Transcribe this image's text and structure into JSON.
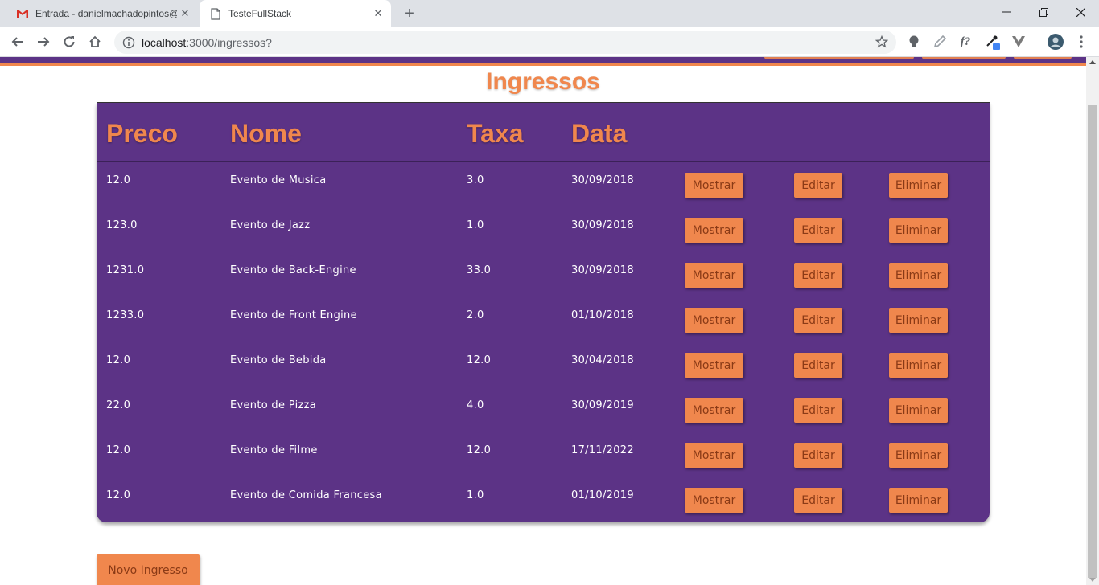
{
  "browser": {
    "tabs": [
      {
        "title": "Entrada - danielmachadopintos@",
        "icon": "gmail-icon",
        "active": false
      },
      {
        "title": "TesteFullStack",
        "icon": "page-icon",
        "active": true
      }
    ],
    "close_glyph": "✕",
    "new_tab_glyph": "+",
    "window_controls": {
      "minimize": "—",
      "restore": "❐",
      "close": "✕"
    },
    "address": {
      "host": "localhost",
      "path": ":3000/ingressos?"
    },
    "extensions": {
      "formula": "f?"
    }
  },
  "page": {
    "title": "Ingressos",
    "columns": [
      "Preco",
      "Nome",
      "Taxa",
      "Data"
    ],
    "action_labels": {
      "show": "Mostrar",
      "edit": "Editar",
      "delete": "Eliminar"
    },
    "rows": [
      {
        "preco": "12.0",
        "nome": "Evento de Musica",
        "taxa": "3.0",
        "data": "30/09/2018"
      },
      {
        "preco": "123.0",
        "nome": "Evento de Jazz",
        "taxa": "1.0",
        "data": "30/09/2018"
      },
      {
        "preco": "1231.0",
        "nome": "Evento de Back-Engine",
        "taxa": "33.0",
        "data": "30/09/2018"
      },
      {
        "preco": "1233.0",
        "nome": "Evento de Front Engine",
        "taxa": "2.0",
        "data": "01/10/2018"
      },
      {
        "preco": "12.0",
        "nome": "Evento de Bebida",
        "taxa": "12.0",
        "data": "30/04/2018"
      },
      {
        "preco": "22.0",
        "nome": "Evento de Pizza",
        "taxa": "4.0",
        "data": "30/09/2019"
      },
      {
        "preco": "12.0",
        "nome": "Evento de Filme",
        "taxa": "12.0",
        "data": "17/11/2022"
      },
      {
        "preco": "12.0",
        "nome": "Evento de Comida Francesa",
        "taxa": "1.0",
        "data": "01/10/2019"
      }
    ],
    "new_button": "Novo Ingresso"
  },
  "colors": {
    "brand_purple": "#5c3386",
    "accent_orange": "#f0874d"
  }
}
